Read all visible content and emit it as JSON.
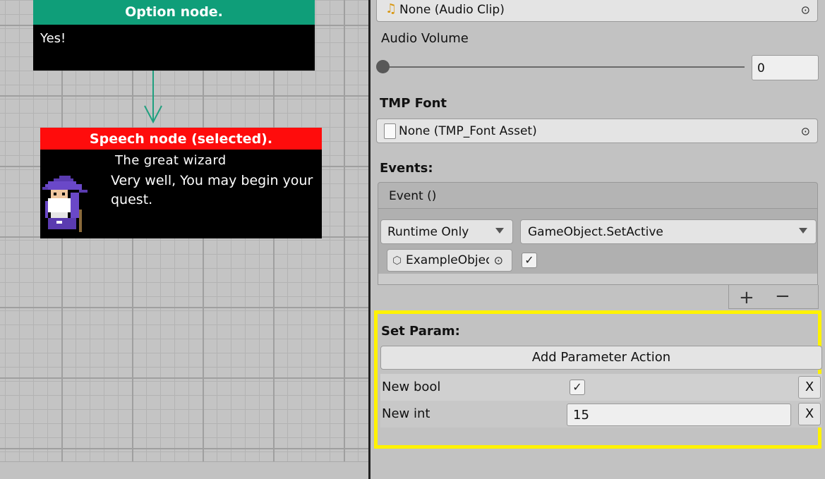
{
  "graph": {
    "option_node": {
      "title": "Option node.",
      "text": "Yes!"
    },
    "speech_node": {
      "title": "Speech node (selected).",
      "speaker": "The great wizard",
      "text": "Very well, You may begin your quest."
    },
    "colors": {
      "option_header": "#0f9e79",
      "speech_header": "#ff0c0c",
      "connector": "#1fa07f"
    }
  },
  "inspector": {
    "audio_clip": {
      "value": "None (Audio Clip)",
      "icon": "music-note-icon"
    },
    "audio_volume": {
      "label": "Audio Volume",
      "value": "0",
      "slider_fraction": 0
    },
    "tmp_font": {
      "label": "TMP Font",
      "value": "None (TMP_Font Asset)",
      "icon": "document-icon"
    },
    "events": {
      "label": "Events:",
      "header": "Event ()",
      "runtime_mode": "Runtime Only",
      "function": "GameObject.SetActive",
      "target_object": "ExampleObject",
      "active_checked": true,
      "add_label": "+",
      "remove_label": "−"
    },
    "set_param": {
      "label": "Set Param:",
      "add_button": "Add Parameter Action",
      "params": [
        {
          "name": "New bool",
          "type": "bool",
          "value": true,
          "remove_label": "X"
        },
        {
          "name": "New int",
          "type": "int",
          "value": "15",
          "remove_label": "X"
        }
      ],
      "highlight_color": "#fff200"
    }
  }
}
